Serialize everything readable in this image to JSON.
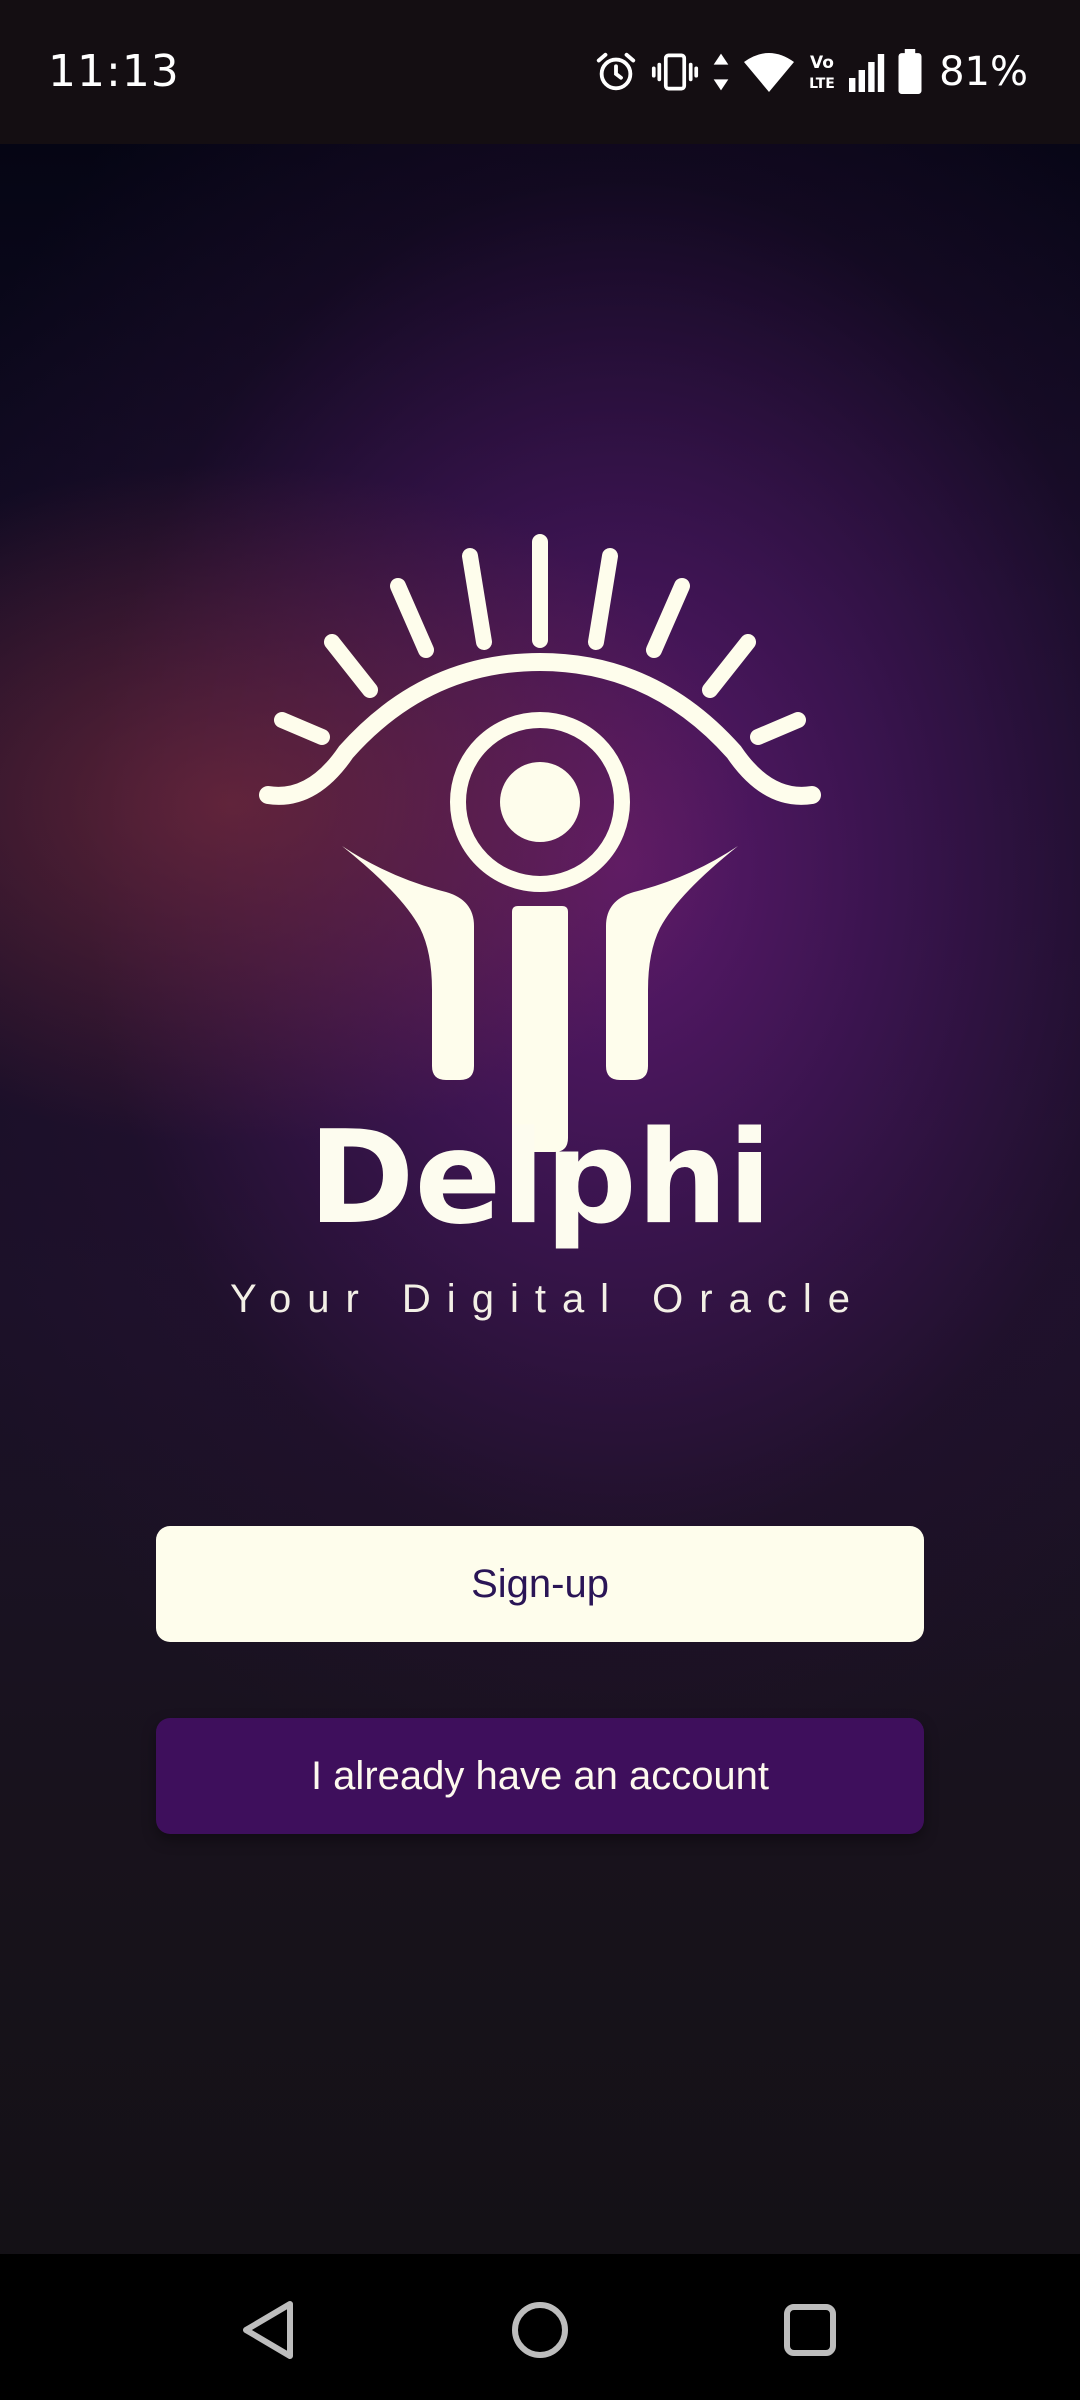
{
  "status_bar": {
    "time": "11:13",
    "icons": [
      "alarm-icon",
      "vibrate-icon",
      "data-arrows-icon",
      "wifi-icon",
      "volte-icon",
      "signal-icon",
      "battery-icon"
    ],
    "volte_label": "Vo LTE",
    "battery_percent": "81%"
  },
  "app": {
    "logo_icon": "oracle-eye-icon",
    "title": "Delphi",
    "tagline": "Your Digital Oracle",
    "signup_label": "Sign-up",
    "login_label": "I already have an account"
  },
  "colors": {
    "cream": "#fefdec",
    "purple_button": "#3e0f5c",
    "signup_text": "#2a1556",
    "background_dark": "#141116"
  },
  "nav_bar": {
    "icons": [
      "back-icon",
      "home-icon",
      "recents-icon"
    ]
  }
}
